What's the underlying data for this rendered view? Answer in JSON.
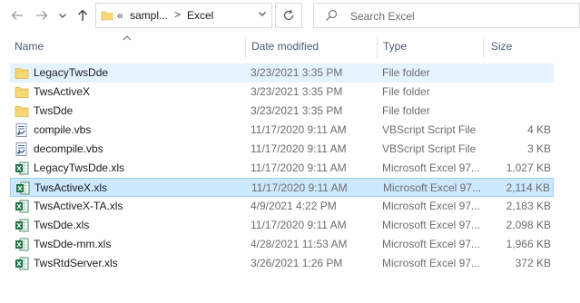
{
  "nav": {
    "back_icon": "arrow-left-icon",
    "forward_icon": "arrow-right-icon",
    "dropdown_icon": "chevron-down-icon",
    "up_icon": "arrow-up-icon"
  },
  "address": {
    "overflow": "«",
    "crumbs": [
      "sampl...",
      "Excel"
    ],
    "separator": ">"
  },
  "search": {
    "placeholder": "Search Excel"
  },
  "columns": {
    "name": "Name",
    "date": "Date modified",
    "type": "Type",
    "size": "Size"
  },
  "files": [
    {
      "name": "LegacyTwsDde",
      "date": "3/23/2021 3:35 PM",
      "type": "File folder",
      "size": "",
      "icon": "folder-icon",
      "state": "hover"
    },
    {
      "name": "TwsActiveX",
      "date": "3/23/2021 3:35 PM",
      "type": "File folder",
      "size": "",
      "icon": "folder-icon",
      "state": ""
    },
    {
      "name": "TwsDde",
      "date": "3/23/2021 3:35 PM",
      "type": "File folder",
      "size": "",
      "icon": "folder-icon",
      "state": ""
    },
    {
      "name": "compile.vbs",
      "date": "11/17/2020 9:11 AM",
      "type": "VBScript Script File",
      "size": "4 KB",
      "icon": "vbs-file-icon",
      "state": ""
    },
    {
      "name": "decompile.vbs",
      "date": "11/17/2020 9:11 AM",
      "type": "VBScript Script File",
      "size": "3 KB",
      "icon": "vbs-file-icon",
      "state": ""
    },
    {
      "name": "LegacyTwsDde.xls",
      "date": "11/17/2020 9:11 AM",
      "type": "Microsoft Excel 97...",
      "size": "1,027 KB",
      "icon": "excel-file-icon",
      "state": ""
    },
    {
      "name": "TwsActiveX.xls",
      "date": "11/17/2020 9:11 AM",
      "type": "Microsoft Excel 97...",
      "size": "2,114 KB",
      "icon": "excel-file-icon",
      "state": "selected"
    },
    {
      "name": "TwsActiveX-TA.xls",
      "date": "4/9/2021 4:22 PM",
      "type": "Microsoft Excel 97...",
      "size": "2,183 KB",
      "icon": "excel-file-icon",
      "state": ""
    },
    {
      "name": "TwsDde.xls",
      "date": "11/17/2020 9:11 AM",
      "type": "Microsoft Excel 97...",
      "size": "2,098 KB",
      "icon": "excel-file-icon",
      "state": ""
    },
    {
      "name": "TwsDde-mm.xls",
      "date": "4/28/2021 11:53 AM",
      "type": "Microsoft Excel 97...",
      "size": "1,966 KB",
      "icon": "excel-file-icon",
      "state": ""
    },
    {
      "name": "TwsRtdServer.xls",
      "date": "3/26/2021 1:26 PM",
      "type": "Microsoft Excel 97...",
      "size": "372 KB",
      "icon": "excel-file-icon",
      "state": ""
    }
  ],
  "colors": {
    "selected_bg": "#cce8ff",
    "selected_border": "#99d1ff",
    "hover_bg": "#e5f3ff",
    "folder": "#f8d775",
    "excel": "#1f7244"
  }
}
